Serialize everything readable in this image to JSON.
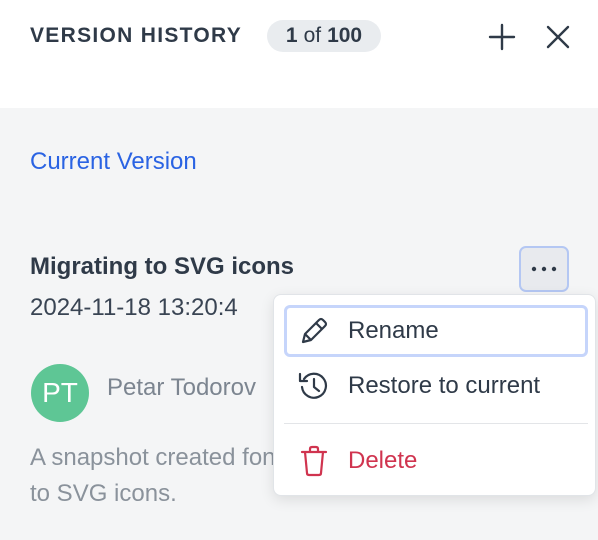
{
  "header": {
    "title": "VERSION HISTORY",
    "count": {
      "current": "1",
      "of_label": "of",
      "total": "100"
    },
    "add_icon": "plus-icon",
    "close_icon": "close-icon"
  },
  "current_version_link": "Current Version",
  "entry": {
    "title": "Migrating to SVG icons",
    "date": "2024-11-18 13:20:4",
    "author_initials": "PT",
    "author_name": "Petar Todorov",
    "description": "A snapshot created font icons to SVG icons."
  },
  "menu": {
    "items": [
      {
        "label": "Rename",
        "icon": "pencil-icon"
      },
      {
        "label": "Restore to current",
        "icon": "history-icon"
      },
      {
        "label": "Delete",
        "icon": "trash-icon"
      }
    ]
  },
  "colors": {
    "accent": "#2a63e3",
    "avatar": "#5ec695",
    "danger": "#d0344f",
    "focus_ring": "#c6d5fb"
  }
}
